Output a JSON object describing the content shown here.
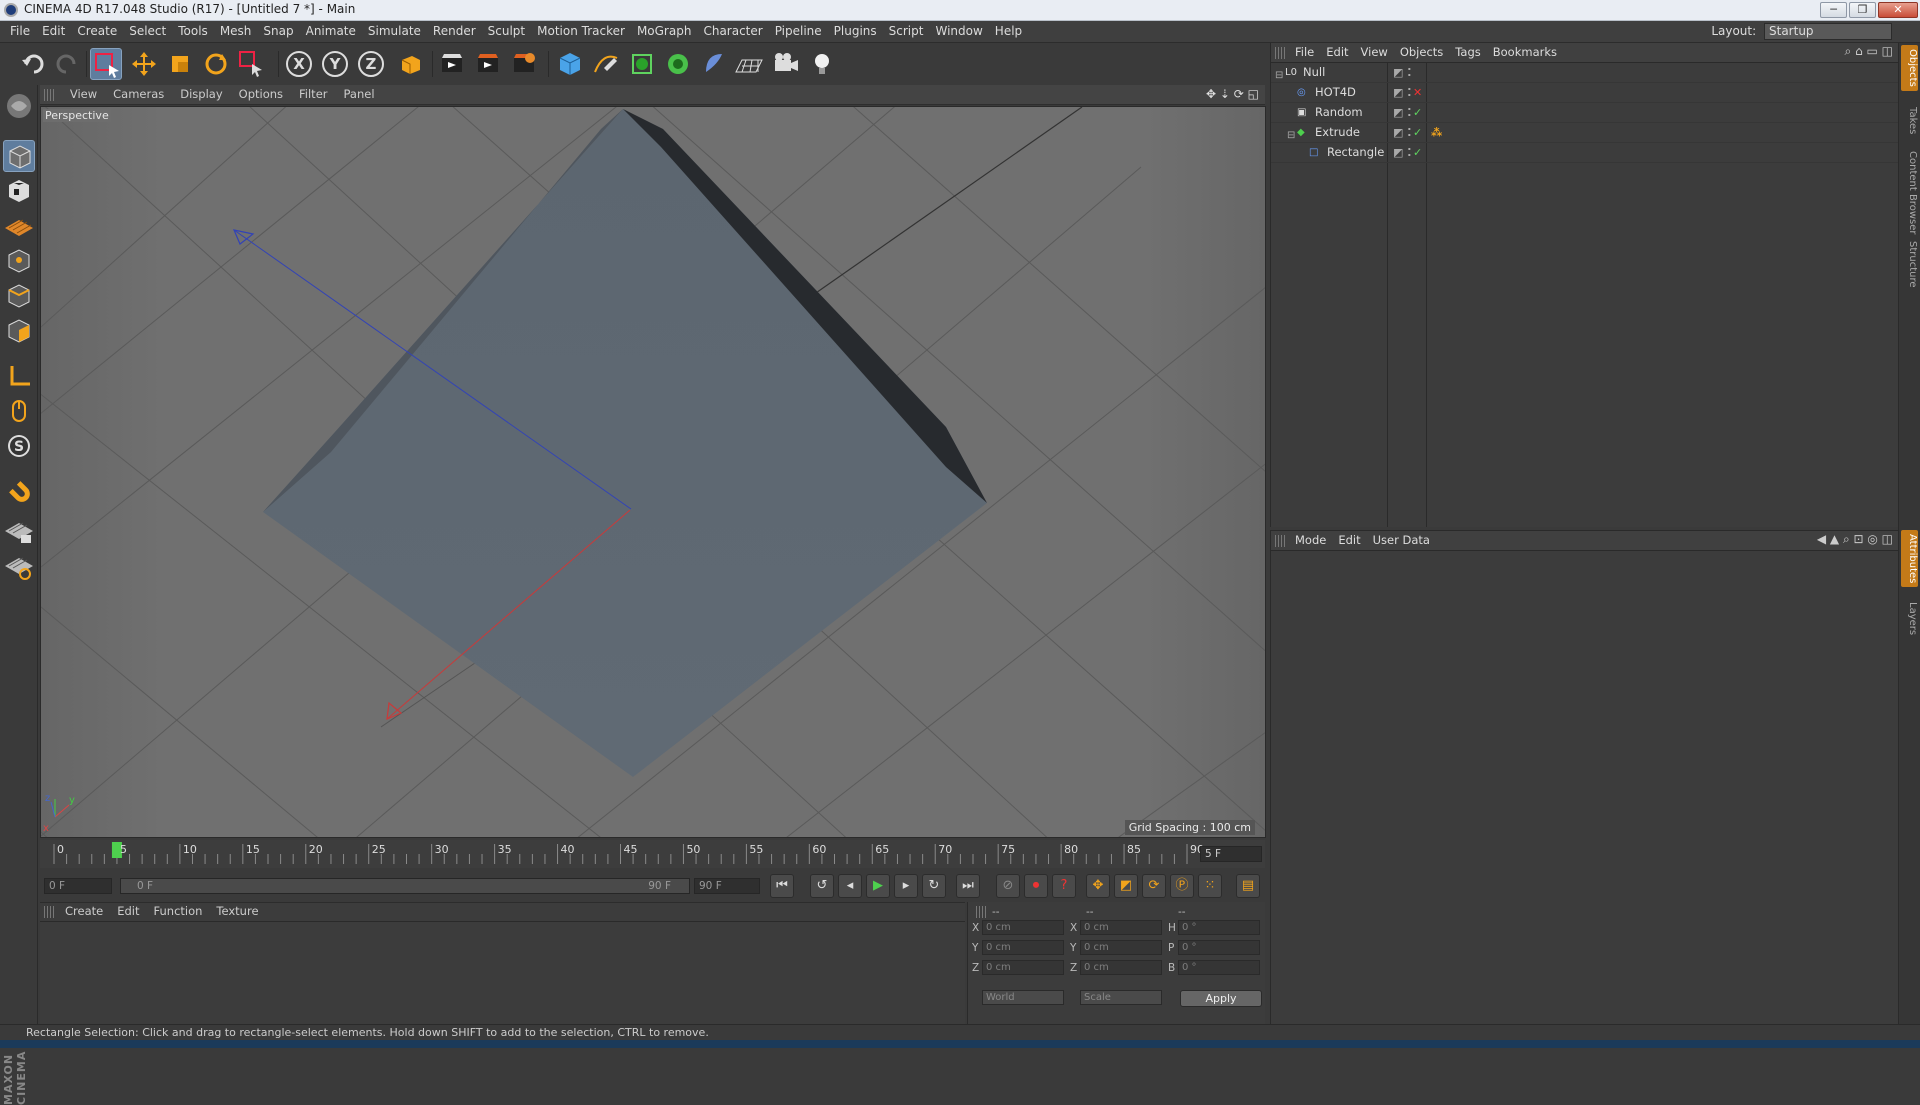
{
  "window": {
    "title": "CINEMA 4D R17.048 Studio (R17) - [Untitled 7 *] - Main",
    "minimize": "─",
    "maximize": "❐",
    "close": "✕"
  },
  "menubar": {
    "items": [
      "File",
      "Edit",
      "Create",
      "Select",
      "Tools",
      "Mesh",
      "Snap",
      "Animate",
      "Simulate",
      "Render",
      "Sculpt",
      "Motion Tracker",
      "MoGraph",
      "Character",
      "Pipeline",
      "Plugins",
      "Script",
      "Window",
      "Help"
    ],
    "layout_label": "Layout:",
    "layout_value": "Startup"
  },
  "toolbar": {
    "axis_x": "X",
    "axis_y": "Y",
    "axis_z": "Z"
  },
  "viewport": {
    "menu": [
      "View",
      "Cameras",
      "Display",
      "Options",
      "Filter",
      "Panel"
    ],
    "camera_label": "Perspective",
    "grid_spacing": "Grid Spacing : 100 cm"
  },
  "timeline": {
    "ticks": [
      "0",
      "5",
      "10",
      "15",
      "20",
      "25",
      "30",
      "35",
      "40",
      "45",
      "50",
      "55",
      "60",
      "65",
      "70",
      "75",
      "80",
      "85",
      "90"
    ],
    "current_frame": "5 F",
    "current_frame_value": 5,
    "max_frame": 90,
    "start_field": "0 F",
    "range_start": "0 F",
    "range_end": "90 F",
    "end_field": "90 F"
  },
  "material_manager": {
    "menu": [
      "Create",
      "Edit",
      "Function",
      "Texture"
    ]
  },
  "coordinates": {
    "headers": [
      "--",
      "--",
      "--"
    ],
    "rows": [
      {
        "a": "X",
        "v1": "0 cm",
        "b": "X",
        "v2": "0 cm",
        "c": "H",
        "v3": "0 °"
      },
      {
        "a": "Y",
        "v1": "0 cm",
        "b": "Y",
        "v2": "0 cm",
        "c": "P",
        "v3": "0 °"
      },
      {
        "a": "Z",
        "v1": "0 cm",
        "b": "Z",
        "v2": "0 cm",
        "c": "B",
        "v3": "0 °"
      }
    ],
    "mode_world": "World",
    "mode_scale": "Scale",
    "apply": "Apply"
  },
  "object_manager": {
    "menu": [
      "File",
      "Edit",
      "View",
      "Objects",
      "Tags",
      "Bookmarks"
    ],
    "objects": [
      {
        "name": "Null",
        "indent": 0,
        "status": ""
      },
      {
        "name": "HOT4D",
        "indent": 1,
        "status": "✕"
      },
      {
        "name": "Random",
        "indent": 1,
        "status": "✓"
      },
      {
        "name": "Extrude",
        "indent": 1,
        "status": "✓"
      },
      {
        "name": "Rectangle",
        "indent": 2,
        "status": "✓"
      }
    ]
  },
  "attribute_manager": {
    "menu": [
      "Mode",
      "Edit",
      "User Data"
    ]
  },
  "right_tabs": {
    "top": [
      "Objects",
      "Takes",
      "Content Browser",
      "Structure"
    ],
    "bottom": [
      "Attributes",
      "Layers"
    ]
  },
  "branding": {
    "maxon": "MAXON CINEMA 4D"
  },
  "statusbar": {
    "text": "Rectangle Selection: Click and drag to rectangle-select elements. Hold down SHIFT to add to the selection, CTRL to remove."
  },
  "colors": {
    "accent": "#c47a18",
    "selected_tool": "#5f7d9e",
    "viewport_bg": "#6d6d6d",
    "object_face": "#5c6670"
  }
}
